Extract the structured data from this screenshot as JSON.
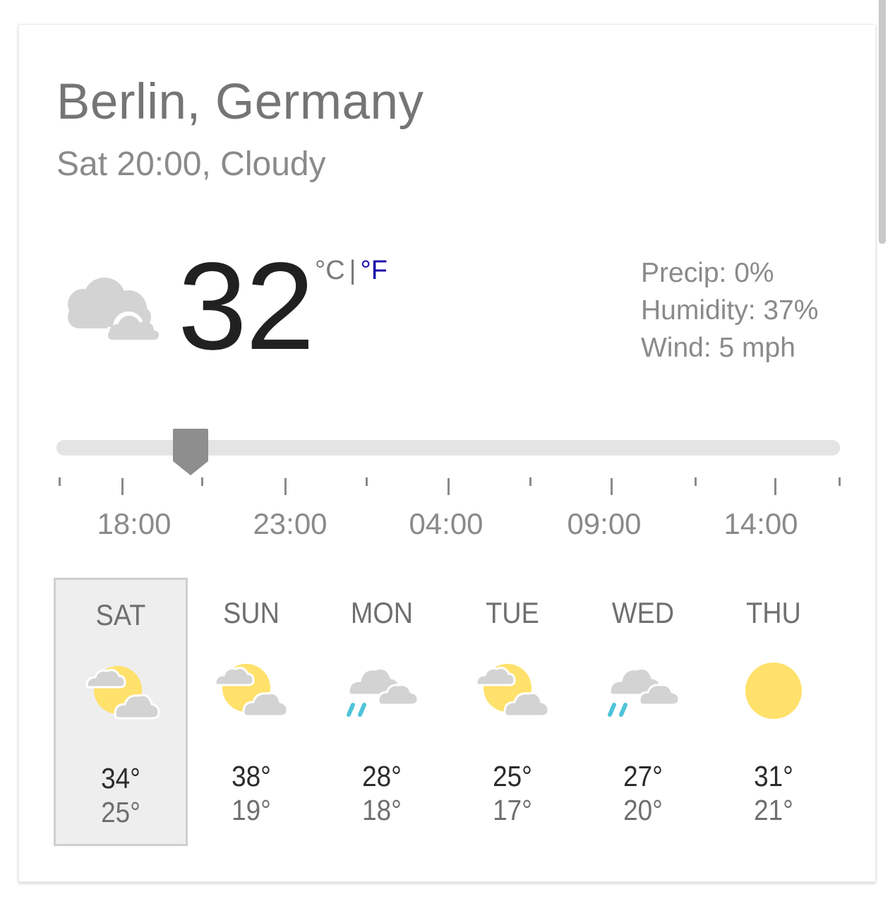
{
  "location": "Berlin, Germany",
  "subtitle": "Sat 20:00, Cloudy",
  "current": {
    "temperature": "32",
    "icon": "cloudy-icon",
    "unit_celsius": "°C",
    "unit_separator": "|",
    "unit_fahrenheit": "°F",
    "precip": "Precip: 0%",
    "humidity": "Humidity: 37%",
    "wind": "Wind: 5 mph"
  },
  "timeline": {
    "position": 0.171,
    "hour_labels": [
      "18:00",
      "23:00",
      "04:00",
      "09:00",
      "14:00"
    ]
  },
  "forecast": [
    {
      "day": "SAT",
      "icon": "partly-cloudy-icon",
      "high": "34°",
      "low": "25°",
      "selected": true
    },
    {
      "day": "SUN",
      "icon": "partly-cloudy-icon",
      "high": "38°",
      "low": "19°",
      "selected": false
    },
    {
      "day": "MON",
      "icon": "rain-icon",
      "high": "28°",
      "low": "18°",
      "selected": false
    },
    {
      "day": "TUE",
      "icon": "partly-cloudy-icon",
      "high": "25°",
      "low": "17°",
      "selected": false
    },
    {
      "day": "WED",
      "icon": "rain-icon",
      "high": "27°",
      "low": "20°",
      "selected": false
    },
    {
      "day": "THU",
      "icon": "sunny-icon",
      "high": "31°",
      "low": "21°",
      "selected": false
    }
  ],
  "colors": {
    "sun": "#ffe16b",
    "cloud": "#d3d3d3",
    "rain": "#4fc3d9",
    "thumb": "#8e8e8e",
    "link": "#1a0dab"
  }
}
